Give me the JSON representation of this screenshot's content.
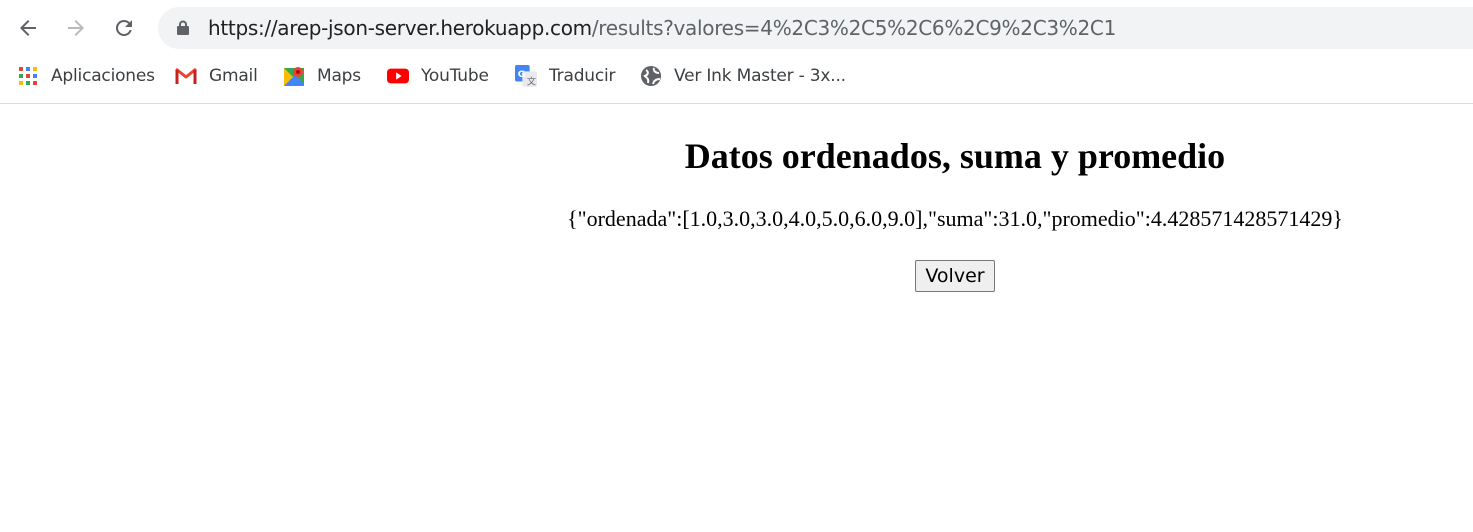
{
  "browser": {
    "url_host": "https://arep-json-server.herokuapp.com",
    "url_rest": "/results?valores=4%2C3%2C5%2C6%2C9%2C3%2C1",
    "bookmarks": [
      {
        "label": "Aplicaciones",
        "icon": "apps-grid-icon"
      },
      {
        "label": "Gmail",
        "icon": "gmail-icon"
      },
      {
        "label": "Maps",
        "icon": "maps-icon"
      },
      {
        "label": "YouTube",
        "icon": "youtube-icon"
      },
      {
        "label": "Traducir",
        "icon": "translate-icon"
      },
      {
        "label": "Ver Ink Master - 3x...",
        "icon": "globe-icon"
      }
    ]
  },
  "page": {
    "title": "Datos ordenados, suma y promedio",
    "result": "{\"ordenada\":[1.0,3.0,3.0,4.0,5.0,6.0,9.0],\"suma\":31.0,\"promedio\":4.428571428571429}",
    "button_label": "Volver"
  }
}
